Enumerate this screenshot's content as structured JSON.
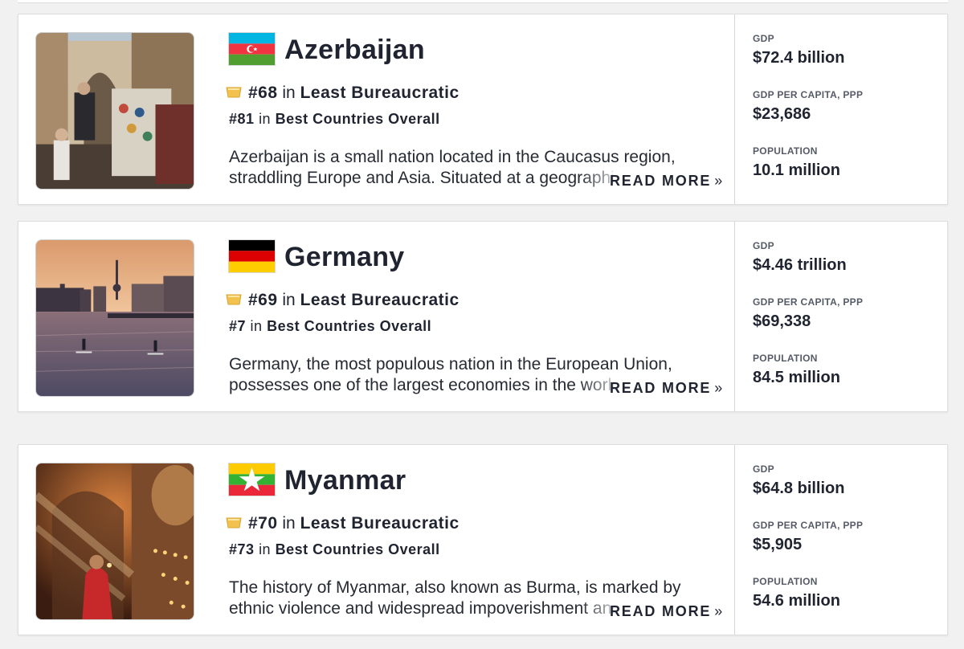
{
  "cards": [
    {
      "country": "Azerbaijan",
      "flag_icon": "azerbaijan-flag",
      "rank_number": "#68",
      "rank_in": "in",
      "rank_category": "Least Bureaucratic",
      "overall_number": "#81",
      "overall_in": "in",
      "overall_category": "Best Countries Overall",
      "description_line1": "Azerbaijan is a small nation located in the Caucasus region,",
      "description_line2": "straddling Europe and Asia. Situated at a geographic",
      "read_more": "READ MORE",
      "read_more_chevron": "»",
      "stats": {
        "gdp_label": "GDP",
        "gdp_value": "$72.4 billion",
        "gdp_per_capita_label": "GDP PER CAPITA, PPP",
        "gdp_per_capita_value": "$23,686",
        "population_label": "POPULATION",
        "population_value": "10.1 million"
      }
    },
    {
      "country": "Germany",
      "flag_icon": "germany-flag",
      "rank_number": "#69",
      "rank_in": "in",
      "rank_category": "Least Bureaucratic",
      "overall_number": "#7",
      "overall_in": "in",
      "overall_category": "Best Countries Overall",
      "description_line1": "Germany, the most populous nation in the European Union,",
      "description_line2": "possesses one of the largest economies in the world",
      "read_more": "READ MORE",
      "read_more_chevron": "»",
      "stats": {
        "gdp_label": "GDP",
        "gdp_value": "$4.46 trillion",
        "gdp_per_capita_label": "GDP PER CAPITA, PPP",
        "gdp_per_capita_value": "$69,338",
        "population_label": "POPULATION",
        "population_value": "84.5 million"
      }
    },
    {
      "country": "Myanmar",
      "flag_icon": "myanmar-flag",
      "rank_number": "#70",
      "rank_in": "in",
      "rank_category": "Least Bureaucratic",
      "overall_number": "#73",
      "overall_in": "in",
      "overall_category": "Best Countries Overall",
      "description_line1": "The history of Myanmar, also known as Burma, is marked by",
      "description_line2": "ethnic violence and widespread impoverishment and",
      "read_more": "READ MORE",
      "read_more_chevron": "»",
      "stats": {
        "gdp_label": "GDP",
        "gdp_value": "$64.8 billion",
        "gdp_per_capita_label": "GDP PER CAPITA, PPP",
        "gdp_per_capita_value": "$5,905",
        "population_label": "POPULATION",
        "population_value": "54.6 million"
      }
    }
  ],
  "colors": {
    "medal": "#f2c14e",
    "text": "#1f2430",
    "stat_label": "#555b66",
    "card_border": "#dedede"
  }
}
